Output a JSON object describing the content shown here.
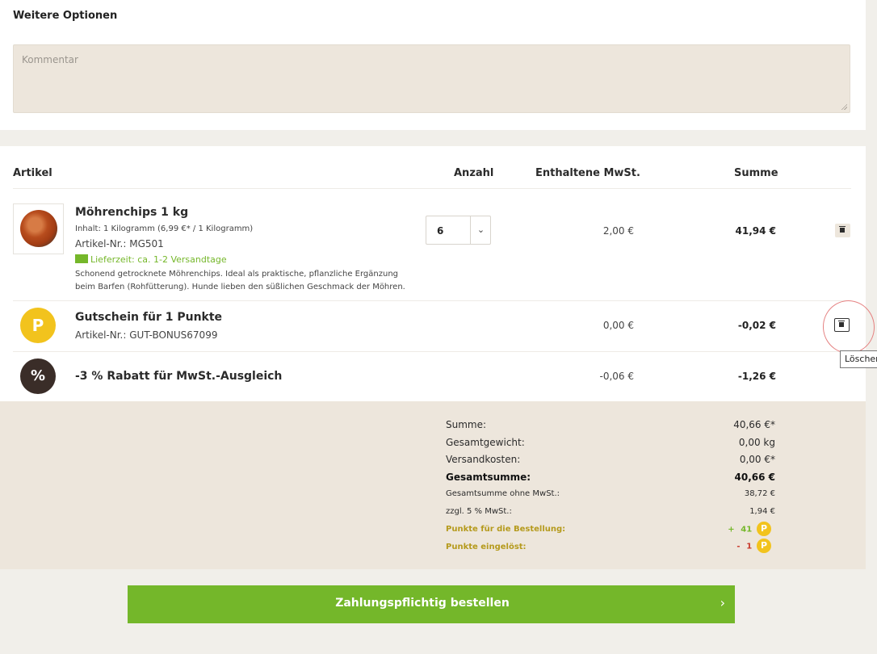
{
  "options": {
    "title": "Weitere Optionen",
    "comment_placeholder": "Kommentar"
  },
  "cart": {
    "headers": {
      "article": "Artikel",
      "quantity": "Anzahl",
      "vat": "Enthaltene MwSt.",
      "sum": "Summe"
    },
    "items": [
      {
        "name": "Möhrenchips 1 kg",
        "content": "Inhalt: 1 Kilogramm (6,99 €* / 1 Kilogramm)",
        "article_no": "Artikel-Nr.: MG501",
        "delivery": "Lieferzeit: ca. 1-2 Versandtage",
        "description": "Schonend getrocknete Möhrenchips. Ideal als praktische, pflanzliche Ergänzung beim Barfen (Rohfütterung). Hunde lieben den süßlichen Geschmack der Möhren.",
        "quantity": "6",
        "vat": "2,00 €",
        "sum": "41,94 €"
      },
      {
        "badge": "P",
        "name": "Gutschein für 1 Punkte",
        "article_no": "Artikel-Nr.: GUT-BONUS67099",
        "vat": "0,00 €",
        "sum": "-0,02 €"
      },
      {
        "badge": "%",
        "name": "-3 % Rabatt für MwSt.-Ausgleich",
        "vat": "-0,06 €",
        "sum": "-1,26 €"
      }
    ],
    "tooltip": "Löschen",
    "colors": {
      "accent_green": "#74b72a",
      "points_gold": "#f2c31d",
      "badge_dark": "#3a2d28"
    }
  },
  "summary": {
    "rows": [
      {
        "label": "Summe:",
        "value": "40,66 €*"
      },
      {
        "label": "Gesamtgewicht:",
        "value": "0,00 kg"
      },
      {
        "label": "Versandkosten:",
        "value": "0,00 €*"
      },
      {
        "label": "Gesamtsumme:",
        "value": "40,66 €"
      },
      {
        "label": "Gesamtsumme ohne MwSt.:",
        "value": "38,72 €"
      },
      {
        "label": "zzgl. 5 % MwSt.:",
        "value": "1,94 €"
      }
    ],
    "points_earned_label": "Punkte für die Bestellung:",
    "points_earned_sign": "+",
    "points_earned_value": "41",
    "points_redeemed_label": "Punkte eingelöst:",
    "points_redeemed_sign": "-",
    "points_redeemed_value": "1",
    "points_badge": "P"
  },
  "order_button": {
    "label": "Zahlungspflichtig bestellen",
    "chevron": "›"
  }
}
